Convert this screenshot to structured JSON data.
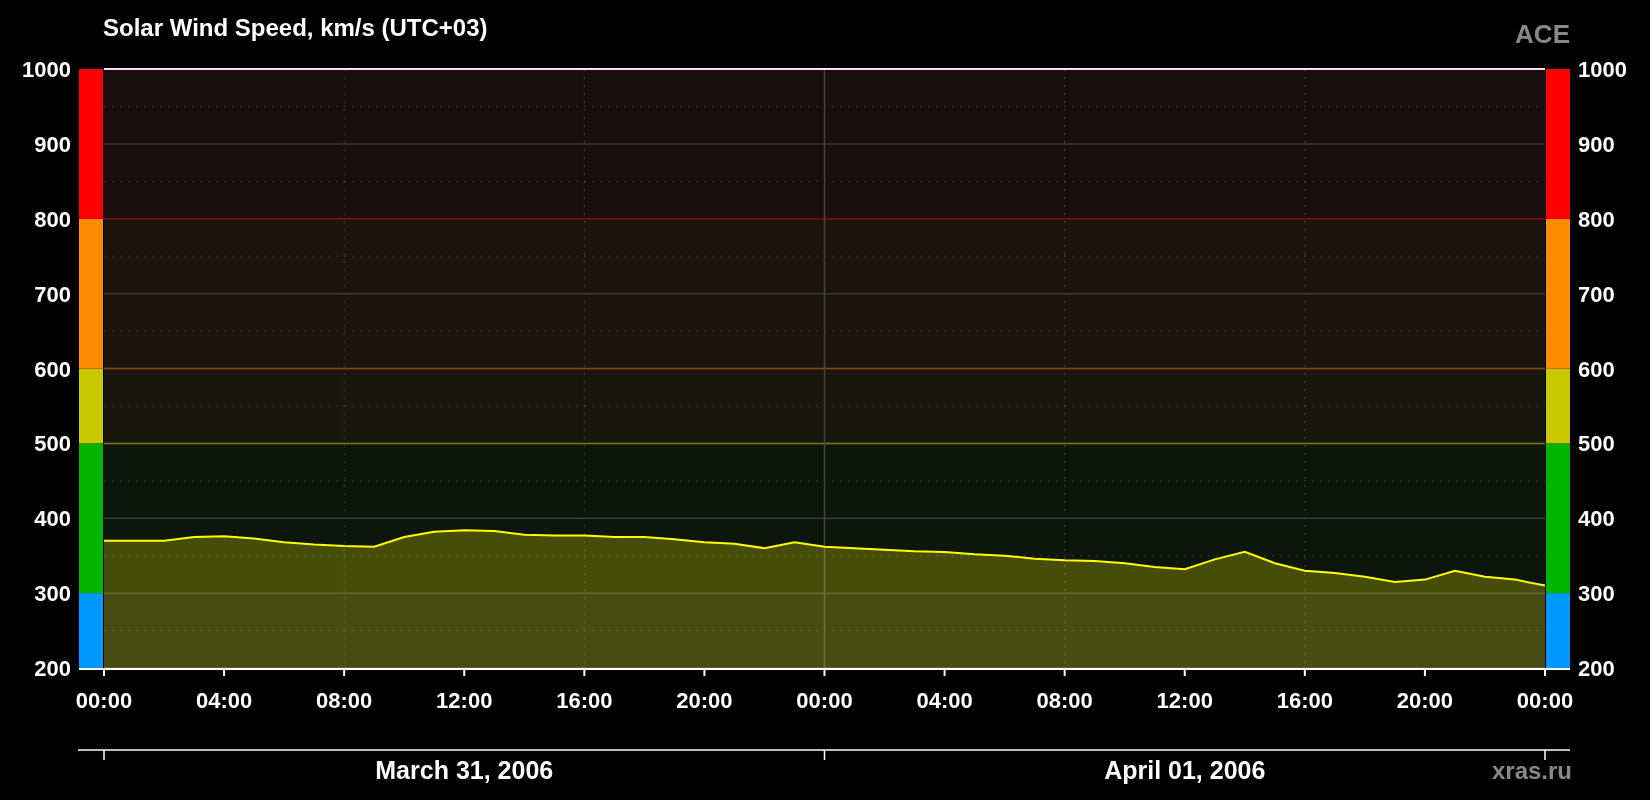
{
  "header": {
    "source": "ACE"
  },
  "chart_data": {
    "type": "area",
    "title": "Solar Wind Speed, km/s (UTC+03)",
    "x": [
      "2006-03-31T00:00",
      "2006-03-31T01:00",
      "2006-03-31T02:00",
      "2006-03-31T03:00",
      "2006-03-31T04:00",
      "2006-03-31T05:00",
      "2006-03-31T06:00",
      "2006-03-31T07:00",
      "2006-03-31T08:00",
      "2006-03-31T09:00",
      "2006-03-31T10:00",
      "2006-03-31T11:00",
      "2006-03-31T12:00",
      "2006-03-31T13:00",
      "2006-03-31T14:00",
      "2006-03-31T15:00",
      "2006-03-31T16:00",
      "2006-03-31T17:00",
      "2006-03-31T18:00",
      "2006-03-31T19:00",
      "2006-03-31T20:00",
      "2006-03-31T21:00",
      "2006-03-31T22:00",
      "2006-03-31T23:00",
      "2006-04-01T00:00",
      "2006-04-01T01:00",
      "2006-04-01T02:00",
      "2006-04-01T03:00",
      "2006-04-01T04:00",
      "2006-04-01T05:00",
      "2006-04-01T06:00",
      "2006-04-01T07:00",
      "2006-04-01T08:00",
      "2006-04-01T09:00",
      "2006-04-01T10:00",
      "2006-04-01T11:00",
      "2006-04-01T12:00",
      "2006-04-01T13:00",
      "2006-04-01T14:00",
      "2006-04-01T15:00",
      "2006-04-01T16:00",
      "2006-04-01T17:00",
      "2006-04-01T18:00",
      "2006-04-01T19:00",
      "2006-04-01T20:00",
      "2006-04-01T21:00",
      "2006-04-01T22:00",
      "2006-04-01T23:00",
      "2006-04-02T00:00"
    ],
    "series": [
      {
        "color": "#ffff00",
        "values": [
          370,
          370,
          370,
          375,
          376,
          373,
          368,
          365,
          363,
          362,
          375,
          382,
          384,
          383,
          378,
          377,
          377,
          375,
          375,
          372,
          368,
          366,
          360,
          368,
          362,
          360,
          358,
          356,
          355,
          352,
          350,
          346,
          344,
          343,
          340,
          335,
          332,
          345,
          355,
          340,
          330,
          327,
          322,
          315,
          318,
          330,
          322,
          318,
          310
        ]
      }
    ],
    "xlim": [
      "2006-03-31T00:00",
      "2006-04-02T00:00"
    ],
    "ylim": [
      200,
      1000
    ],
    "xticks": [
      {
        "value": "2006-03-31T00:00",
        "label": "00:00"
      },
      {
        "value": "2006-03-31T04:00",
        "label": "04:00"
      },
      {
        "value": "2006-03-31T08:00",
        "label": "08:00"
      },
      {
        "value": "2006-03-31T12:00",
        "label": "12:00"
      },
      {
        "value": "2006-03-31T16:00",
        "label": "16:00"
      },
      {
        "value": "2006-03-31T20:00",
        "label": "20:00"
      },
      {
        "value": "2006-04-01T00:00",
        "label": "00:00"
      },
      {
        "value": "2006-04-01T04:00",
        "label": "04:00"
      },
      {
        "value": "2006-04-01T08:00",
        "label": "08:00"
      },
      {
        "value": "2006-04-01T12:00",
        "label": "12:00"
      },
      {
        "value": "2006-04-01T16:00",
        "label": "16:00"
      },
      {
        "value": "2006-04-01T20:00",
        "label": "20:00"
      },
      {
        "value": "2006-04-02T00:00",
        "label": "00:00"
      }
    ],
    "yticks": [
      200,
      300,
      400,
      500,
      600,
      700,
      800,
      900,
      1000
    ],
    "grid": true,
    "ref_lines": [
      {
        "axis": "y",
        "value": 500,
        "color": "#7a7a00"
      },
      {
        "axis": "y",
        "value": 600,
        "color": "#8a4a00"
      },
      {
        "axis": "y",
        "value": 800,
        "color": "#8a0000"
      },
      {
        "axis": "x",
        "value": "2006-04-01T00:00",
        "color": "#444444"
      }
    ],
    "bands": [
      {
        "axis": "y",
        "from": 200,
        "to": 300,
        "color": "#0099ff"
      },
      {
        "axis": "y",
        "from": 300,
        "to": 500,
        "color": "#00b400"
      },
      {
        "axis": "y",
        "from": 500,
        "to": 600,
        "color": "#c8c800"
      },
      {
        "axis": "y",
        "from": 600,
        "to": 800,
        "color": "#ff8c00"
      },
      {
        "axis": "y",
        "from": 800,
        "to": 1000,
        "color": "#ff0000"
      }
    ]
  },
  "right_axis_labels": [
    "1000",
    "900",
    "800",
    "700",
    "600",
    "500",
    "400",
    "300",
    "200"
  ],
  "date_labels": [
    "March 31, 2006",
    "April 01, 2006"
  ],
  "footer": {
    "site": "xras.ru"
  }
}
